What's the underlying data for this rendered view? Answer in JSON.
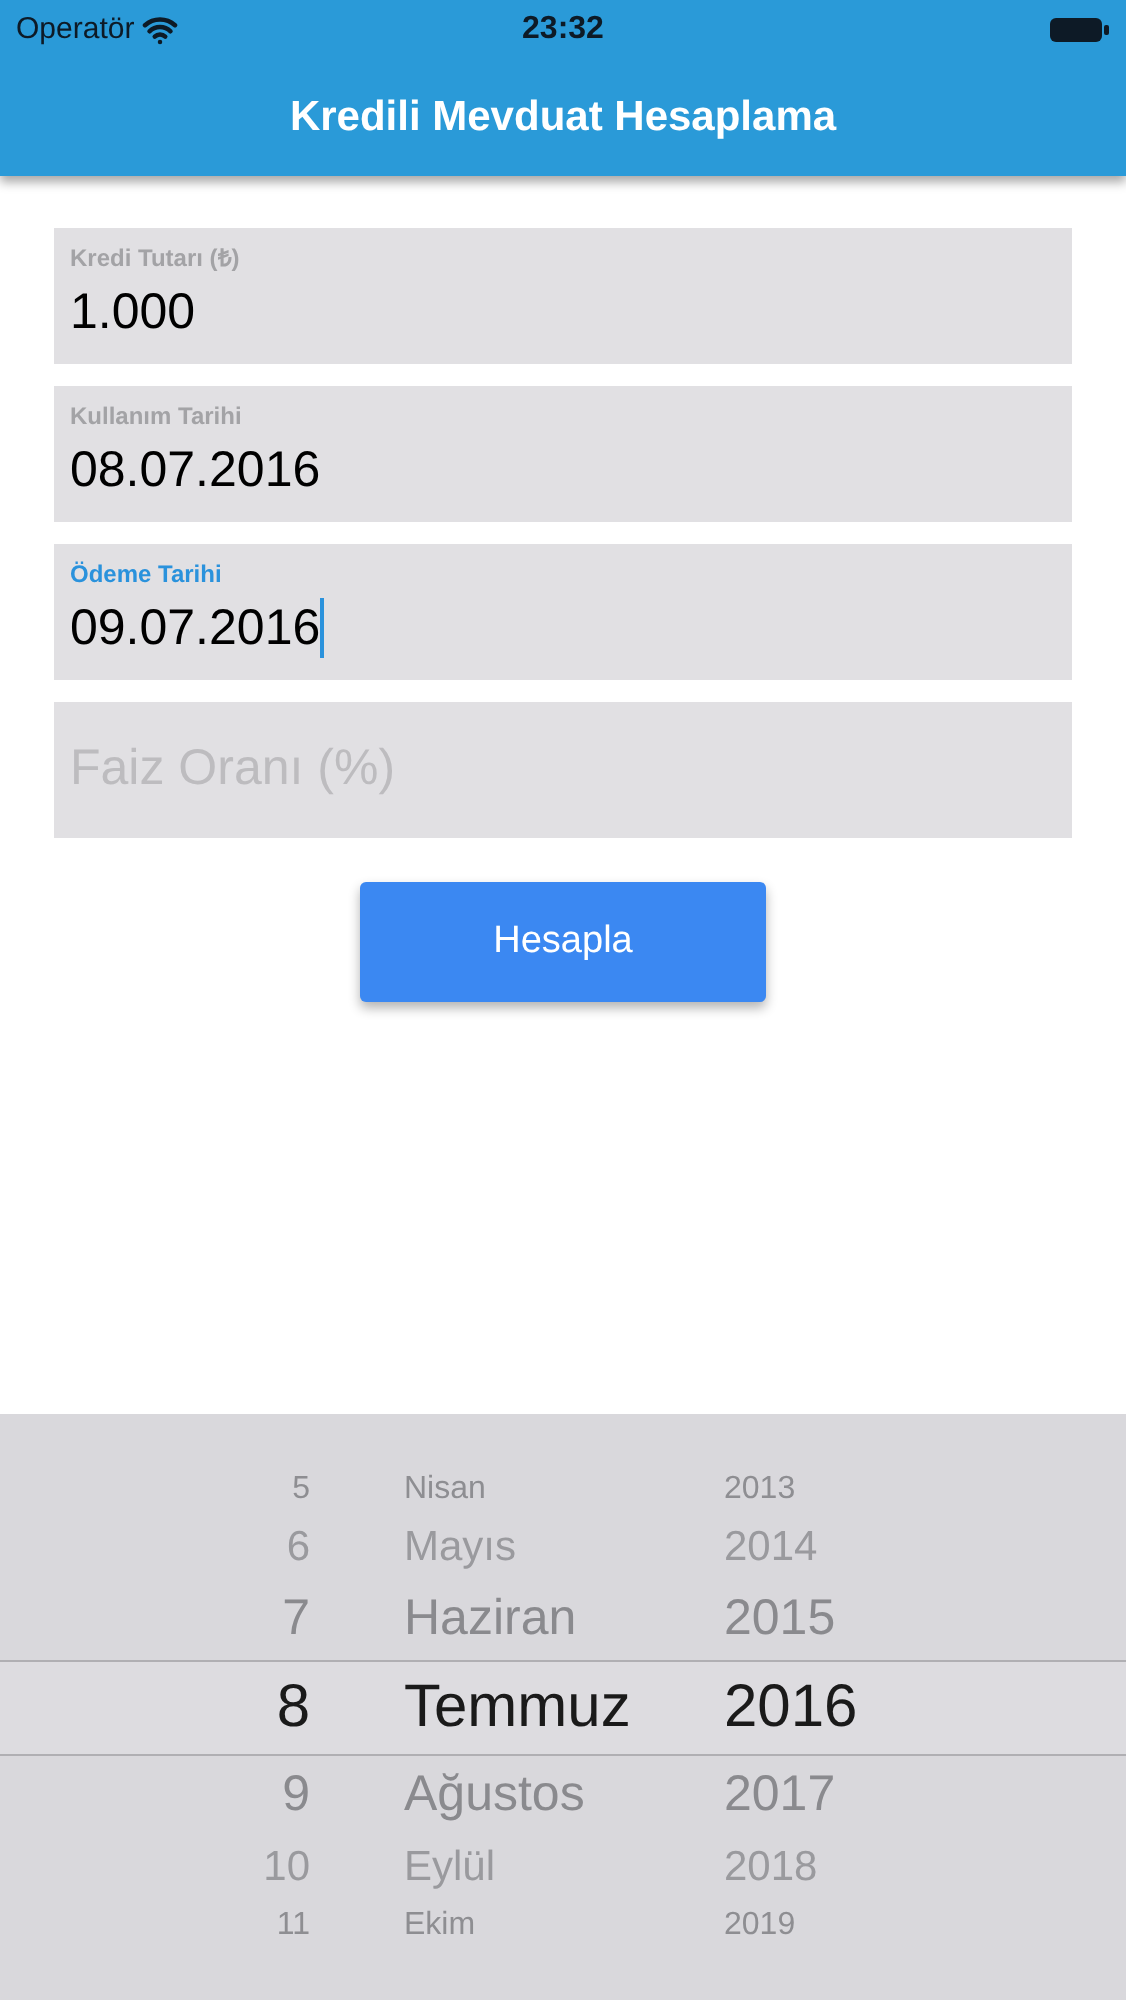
{
  "status_bar": {
    "carrier": "Operatör",
    "time": "23:32"
  },
  "nav_bar": {
    "title": "Kredili Mevduat Hesaplama"
  },
  "fields": [
    {
      "kind": "filled",
      "label": "Kredi Tutarı (₺)",
      "value": "1.000",
      "focused": false
    },
    {
      "kind": "filled",
      "label": "Kullanım Tarihi",
      "value": "08.07.2016",
      "focused": false
    },
    {
      "kind": "filled",
      "label": "Ödeme Tarihi",
      "value": "09.07.2016",
      "focused": true
    },
    {
      "kind": "empty",
      "placeholder": "Faiz Oranı (%)",
      "focused": false
    }
  ],
  "button": {
    "label": "Hesapla"
  },
  "picker": {
    "rows": [
      {
        "day": "5",
        "month": "Nisan",
        "year": "2013",
        "selected": false
      },
      {
        "day": "6",
        "month": "Mayıs",
        "year": "2014",
        "selected": false
      },
      {
        "day": "7",
        "month": "Haziran",
        "year": "2015",
        "selected": false
      },
      {
        "day": "8",
        "month": "Temmuz",
        "year": "2016",
        "selected": true
      },
      {
        "day": "9",
        "month": "Ağustos",
        "year": "2017",
        "selected": false
      },
      {
        "day": "10",
        "month": "Eylül",
        "year": "2018",
        "selected": false
      },
      {
        "day": "11",
        "month": "Ekim",
        "year": "2019",
        "selected": false
      }
    ]
  }
}
